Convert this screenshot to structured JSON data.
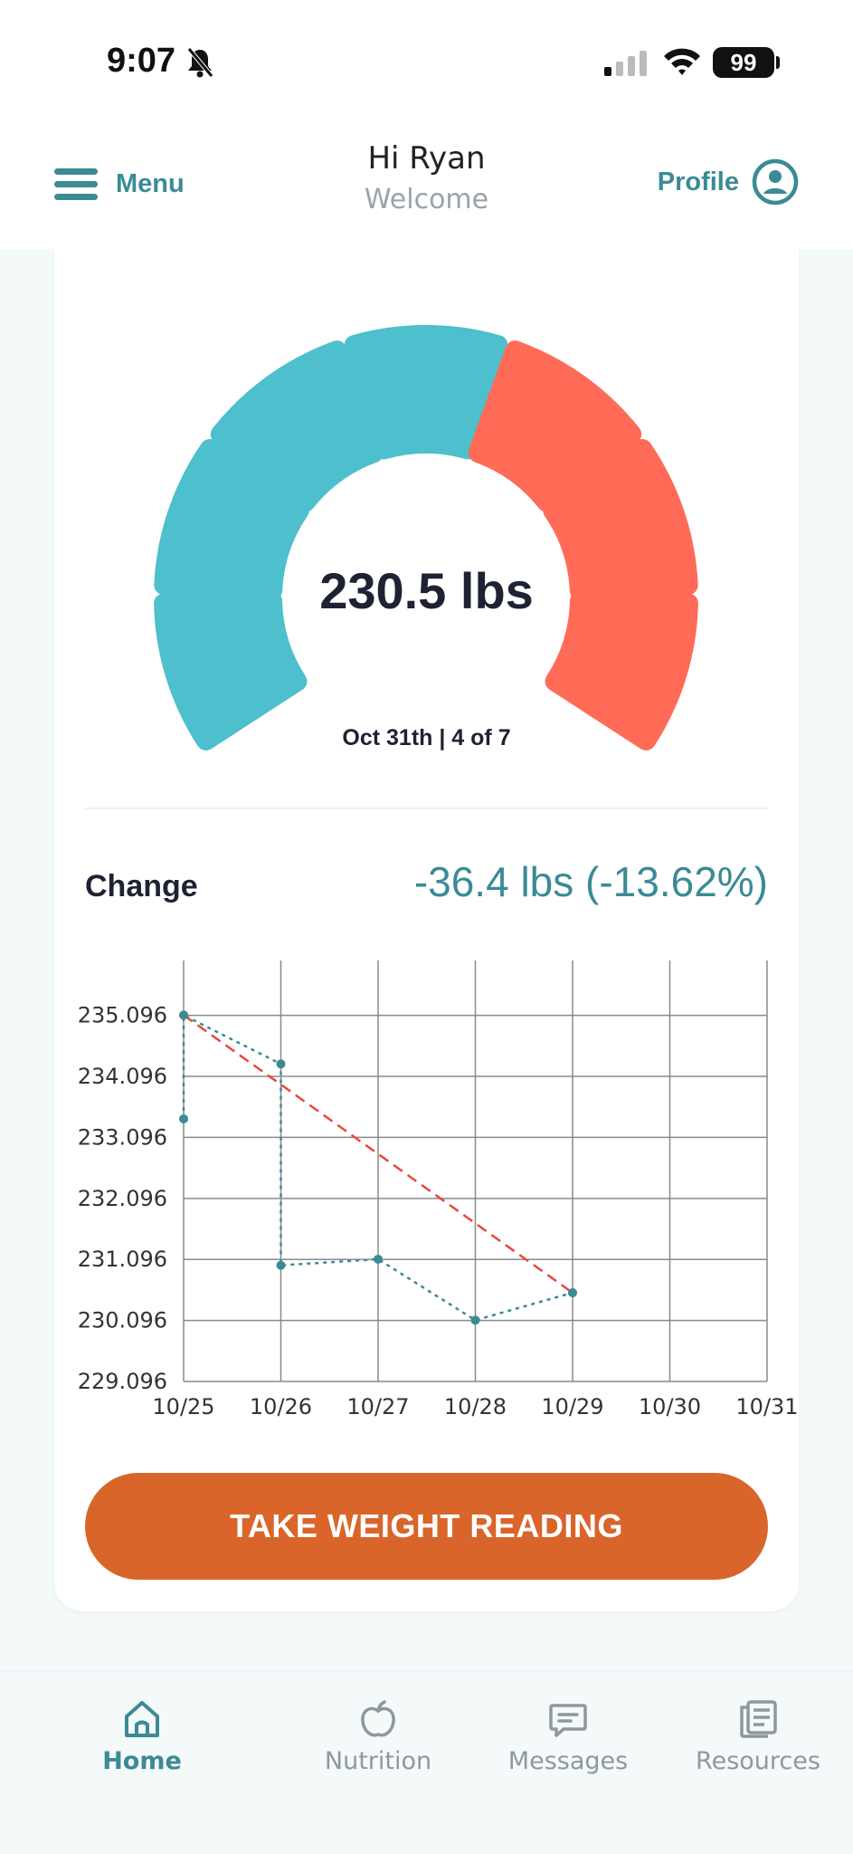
{
  "status_bar": {
    "time": "9:07",
    "battery": "99"
  },
  "header": {
    "menu_label": "Menu",
    "greeting": "Hi Ryan",
    "subtitle": "Welcome",
    "profile_label": "Profile"
  },
  "gauge": {
    "weight": "230.5 lbs",
    "date_label": "Oct 31th | 4 of 7",
    "segments_filled": 4,
    "segments_total": 7,
    "colors": {
      "filled": "#4ebfcc",
      "remaining": "#ff6b57"
    }
  },
  "change": {
    "label": "Change",
    "value": "-36.4 lbs (-13.62%)"
  },
  "chart_data": {
    "type": "line",
    "categories": [
      "10/25",
      "10/26",
      "10/27",
      "10/28",
      "10/29",
      "10/30",
      "10/31"
    ],
    "y_ticks": [
      "235.096",
      "234.096",
      "233.096",
      "232.096",
      "231.096",
      "230.096",
      "229.096"
    ],
    "ylim": [
      229.096,
      235.996
    ],
    "grid": true,
    "series": [
      {
        "values": [
          {
            "x": "10/25",
            "y": 233.4
          },
          {
            "x": "10/25",
            "y": 235.1
          },
          {
            "x": "10/26",
            "y": 234.3
          },
          {
            "x": "10/26",
            "y": 231.0
          },
          {
            "x": "10/27",
            "y": 231.1
          },
          {
            "x": "10/28",
            "y": 230.1
          },
          {
            "x": "10/29",
            "y": 230.55
          }
        ],
        "color": "#3a8b95",
        "style": "dotted"
      },
      {
        "values": [
          {
            "x": "10/25",
            "y": 235.1
          },
          {
            "x": "10/29",
            "y": 230.55
          }
        ],
        "color": "#e8493a",
        "style": "dashed"
      }
    ]
  },
  "cta_label": "TAKE WEIGHT READING",
  "tabs": [
    {
      "label": "Home",
      "icon": "home-icon",
      "active": true
    },
    {
      "label": "Nutrition",
      "icon": "apple-icon",
      "active": false
    },
    {
      "label": "Messages",
      "icon": "message-icon",
      "active": false
    },
    {
      "label": "Resources",
      "icon": "resources-icon",
      "active": false
    }
  ]
}
